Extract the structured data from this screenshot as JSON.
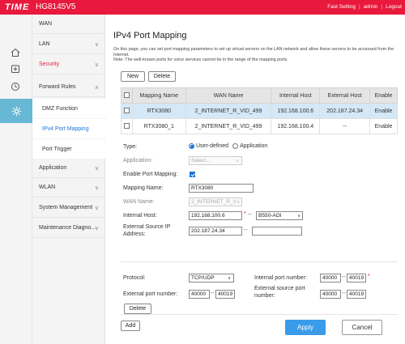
{
  "header": {
    "logo": "TIME",
    "model": "HG8145V5",
    "fast_setting": "Fast Setting",
    "sep": "|",
    "user": "admin",
    "logout": "Logout"
  },
  "icons": {
    "home": "home-icon",
    "add": "plus-box-icon",
    "clock": "clock-icon",
    "gear": "gear-icon"
  },
  "menu": {
    "wan": "WAN",
    "lan": "LAN",
    "security": "Security",
    "forward_rules": "Forward Rules",
    "dmz": "DMZ Function",
    "ipv4_port_mapping": "IPv4 Port Mapping",
    "port_trigger": "Port Trigger",
    "application": "Application",
    "wlan": "WLAN",
    "system_management": "System Management",
    "maintenance": "Maintenance Diagno..."
  },
  "page": {
    "title": "IPv4 Port Mapping",
    "desc1": "On this page, you can set port mapping parameters to set up virtual servers on the LAN network and allow these servers to be accessed from the Internet.",
    "desc2": "Note: The well-known ports for voice services cannot be in the range of the mapping ports.",
    "new_btn": "New",
    "delete_btn": "Delete"
  },
  "table": {
    "headers": [
      "Mapping Name",
      "WAN Name",
      "Internal Host",
      "External Host",
      "Enable"
    ],
    "rows": [
      {
        "name": "RTX3080",
        "wan": "2_INTERNET_R_VID_499",
        "internal": "192.168.100.6",
        "external": "202.187.24.34",
        "enable": "Enable"
      },
      {
        "name": "RTX3080_1",
        "wan": "2_INTERNET_R_VID_499",
        "internal": "192.168.100.4",
        "external": "--",
        "enable": "Enable"
      }
    ]
  },
  "form": {
    "type_label": "Type:",
    "type_user": "User-defined",
    "type_app": "Application",
    "application_label": "Application:",
    "application_value": "Select...",
    "enable_label": "Enable Port Mapping:",
    "mapping_name_label": "Mapping Name:",
    "mapping_name_value": "RTX3080",
    "wan_name_label": "WAN Name:",
    "wan_name_value": "2_INTERNET_R_V",
    "internal_host_label": "Internal Host:",
    "internal_host_value": "192.168.100.6",
    "internal_host_select": "B550-AOI",
    "external_source_label1": "External Source IP",
    "external_source_label2": "Address:",
    "external_source_value": "202.187.24.34",
    "external_source_value2": "",
    "required": "*",
    "dash": "--"
  },
  "ports": {
    "protocol_label": "Protocol:",
    "protocol_value": "TCP/UDP",
    "internal_port_label": "Internal port number:",
    "internal_port_from": "40000",
    "internal_port_to": "40019",
    "external_port_label": "External port number:",
    "external_port_from": "40000",
    "external_port_to": "40019",
    "external_source_port_label1": "External source port",
    "external_source_port_label2": "number:",
    "external_source_port_from": "40000",
    "external_source_port_to": "40019",
    "delete_btn": "Delete"
  },
  "actions": {
    "add": "Add",
    "apply": "Apply",
    "cancel": "Cancel"
  }
}
